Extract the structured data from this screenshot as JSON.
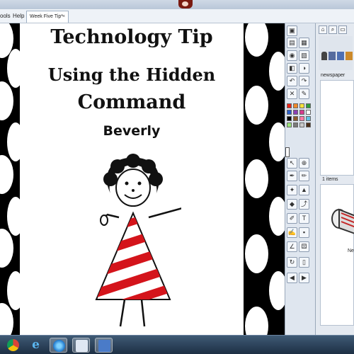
{
  "menubar": {
    "items": [
      "ools",
      "Help"
    ]
  },
  "tab": {
    "label": "Week Five Tip*",
    "close": "×"
  },
  "slide": {
    "title_line1": "Technology Tip",
    "title_line2": "Using the Hidden",
    "title_line3": "Command",
    "author": "Beverly"
  },
  "toolbox": {
    "palette": [
      "#e8241a",
      "#f08a2a",
      "#f5e23c",
      "#2d9a3c",
      "#2a5fc9",
      "#8a3fb5",
      "#d83b8e",
      "#ffffff",
      "#000000",
      "#8b5a2b",
      "#ff7aa8",
      "#60c3e6",
      "#9be37a",
      "#7a7a7a",
      "#c9c9c9",
      "#4b2f1a"
    ]
  },
  "panel": {
    "search_value": "newspaper",
    "results_count": "1 items",
    "result_label": "Ne"
  },
  "taskbar": {
    "apps": [
      "chrome-icon",
      "ie-icon",
      "media-player-icon",
      "paint-icon",
      "promethean-icon"
    ]
  }
}
